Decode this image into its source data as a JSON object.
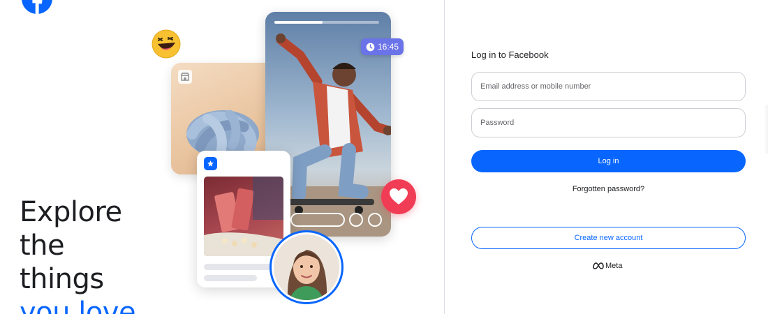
{
  "brand": {
    "logo_icon": "facebook-logo-icon",
    "color": "#0866ff"
  },
  "hero": {
    "headline_lines": [
      "Explore",
      "the",
      "things"
    ],
    "headline_accent": "you love."
  },
  "collage": {
    "video_time": "16:45",
    "video_progress": 0.46,
    "icons": [
      "laughing-emoji-icon",
      "clock-icon",
      "heart-icon",
      "marketplace-icon",
      "reels-icon"
    ]
  },
  "login": {
    "title": "Log in to Facebook",
    "email_placeholder": "Email address or mobile number",
    "email_value": "",
    "password_placeholder": "Password",
    "password_value": "",
    "login_label": "Log in",
    "forgot_label": "Forgotten password?",
    "create_label": "Create new account",
    "meta_label": "Meta"
  },
  "colors": {
    "primary": "#0866ff",
    "text": "#1c1e21",
    "border": "#ccd0d5",
    "heart": "#f03d55",
    "time_badge": "#6b73e8"
  }
}
